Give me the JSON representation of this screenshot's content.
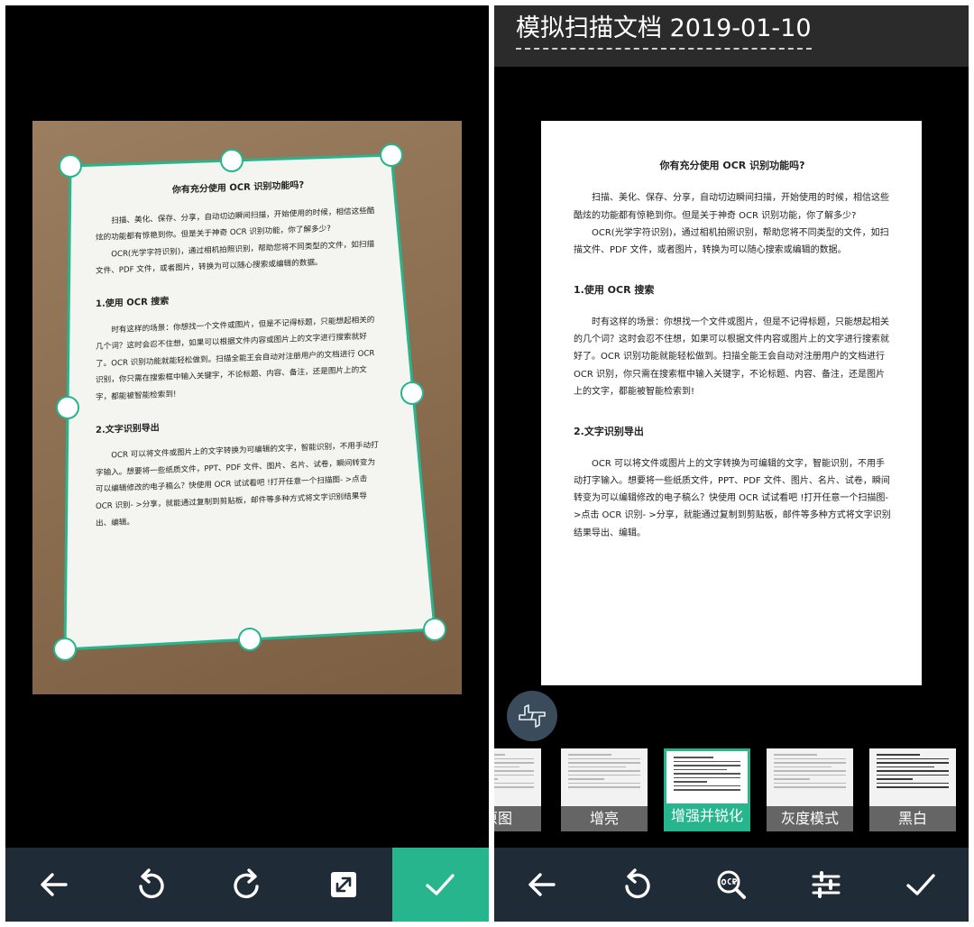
{
  "crop_screen": {
    "document": {
      "title": "你有充分使用 OCR 识别功能吗?",
      "intro": [
        "扫描、美化、保存、分享，自动切边瞬间扫描，开始使用的时候，相信这些酷炫的功能都有惊艳到你。但是关于神奇 OCR 识别功能，你了解多少?",
        "OCR(光学字符识别)，通过相机拍照识别，帮助您将不同类型的文件，如扫描文件、PDF 文件，或者图片，转换为可以随心搜索或编辑的数据。"
      ],
      "section1_heading": "1.使用 OCR 搜索",
      "section1_body": "时有这样的场景：你想找一个文件或图片，但是不记得标题，只能想起相关的几个词？这时会忍不住想，如果可以根据文件内容或图片上的文字进行搜索就好了。OCR 识别功能就能轻松做到。扫描全能王会自动对注册用户的文档进行 OCR 识别，你只需在搜索框中输入关键字，不论标题、内容、备注，还是图片上的文字，都能被智能检索到!",
      "section2_heading": "2.文字识别导出",
      "section2_body": "OCR 可以将文件或图片上的文字转换为可编辑的文字，智能识别，不用手动打字输入。想要将一些纸质文件，PPT、PDF 文件、图片、名片、试卷，瞬间转变为可以编辑修改的电子稿么？快使用 OCR 试试看吧 !打开任意一个扫描图- >点击 OCR 识别- >分享，就能通过复制到剪贴板，邮件等多种方式将文字识别结果导出、编辑。"
    },
    "toolbar": {
      "back_icon": "arrow-left-icon",
      "rotate_left_icon": "rotate-counterclockwise-icon",
      "rotate_right_icon": "rotate-clockwise-icon",
      "expand_icon": "expand-arrows-icon",
      "confirm_icon": "checkmark-icon"
    }
  },
  "filter_screen": {
    "title": "模拟扫描文档 2019-01-10",
    "filters": [
      {
        "label": "原图",
        "selected": false
      },
      {
        "label": "增亮",
        "selected": false
      },
      {
        "label": "增强并锐化",
        "selected": true
      },
      {
        "label": "灰度模式",
        "selected": false
      },
      {
        "label": "黑白",
        "selected": false
      }
    ],
    "toolbar": {
      "back_icon": "arrow-left-icon",
      "rotate_icon": "rotate-counterclockwise-icon",
      "ocr_icon": "ocr-magnifier-icon",
      "adjust_icon": "sliders-icon",
      "confirm_icon": "checkmark-icon"
    },
    "gesture_icon": "thumbs-gesture-icon"
  },
  "colors": {
    "accent": "#26b58c",
    "toolbar_bg": "#1f2b36",
    "title_bar_bg": "#2b2b2b"
  }
}
